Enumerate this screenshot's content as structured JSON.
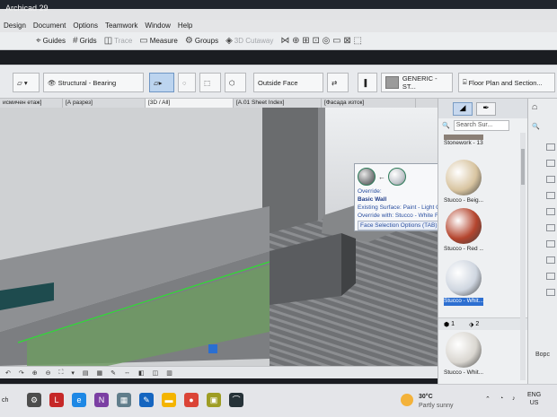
{
  "window": {
    "title": "Archicad 29"
  },
  "menu": [
    "Design",
    "Document",
    "Options",
    "Teamwork",
    "Window",
    "Help"
  ],
  "toolbar": [
    {
      "label": "Guides",
      "icon": "guides-icon",
      "enabled": true
    },
    {
      "label": "Grids",
      "icon": "grids-icon",
      "enabled": true
    },
    {
      "label": "Trace",
      "icon": "trace-icon",
      "enabled": false
    },
    {
      "label": "Measure",
      "icon": "measure-icon",
      "enabled": true
    },
    {
      "label": "Groups",
      "icon": "groups-icon",
      "enabled": true
    },
    {
      "label": "3D Cutaway",
      "icon": "cutaway-icon",
      "enabled": false
    }
  ],
  "infobox": {
    "structure": "Structural - Bearing",
    "reference": "Outside Face",
    "material": "GENERIC - ST...",
    "display": "Floor Plan and Section..."
  },
  "tabs": [
    "[А разрез]",
    "[3D / All]",
    "[A.01 Sheet Index]",
    "[Фасада изток]"
  ],
  "tab_prefix": "исмичен етаж]",
  "tooltip": {
    "line1": "Override:",
    "line2": "Basic Wall",
    "line3": "Existing Surface: Paint - Light Gray",
    "line4": "Override with: Stucco - White Fine",
    "line5": "Face Selection Options (TAB)"
  },
  "panel": {
    "search_placeholder": "Search Sur...",
    "surfaces": [
      {
        "label": "Stonework - 13",
        "color": "#8a7f76"
      },
      {
        "label": "Stucco - Beig...",
        "color": "#d8c4a0"
      },
      {
        "label": "Stucco - Red ...",
        "color": "#b4452e"
      },
      {
        "label": "Stucco - Whit...",
        "color": "#cfd6e0",
        "selected": true
      },
      {
        "label": "Stucco - Whit...",
        "color": "#d9d6d0"
      }
    ],
    "footer_count1": "1",
    "footer_count2": "2"
  },
  "nav": {
    "label": "Ворс"
  },
  "taskbar": {
    "weather_temp": "30°C",
    "weather_desc": "Partly sunny",
    "lang1": "ENG",
    "lang2": "US",
    "search": "ch",
    "apps": [
      {
        "icon": "gear-icon",
        "color": "#4d4d4d",
        "glyph": "⚙"
      },
      {
        "icon": "l-app-icon",
        "color": "#c62828",
        "glyph": "L"
      },
      {
        "icon": "edge-icon",
        "color": "#1e88e5",
        "glyph": "e"
      },
      {
        "icon": "onenote-icon",
        "color": "#7b3fa3",
        "glyph": "N"
      },
      {
        "icon": "calendar-icon",
        "color": "#607d8b",
        "glyph": "▦"
      },
      {
        "icon": "pen-icon",
        "color": "#1565c0",
        "glyph": "✎"
      },
      {
        "icon": "folder-icon",
        "color": "#f4b400",
        "glyph": "▬"
      },
      {
        "icon": "chrome-icon",
        "color": "#db4437",
        "glyph": "●"
      },
      {
        "icon": "image-icon",
        "color": "#9e9d24",
        "glyph": "▣"
      },
      {
        "icon": "archicad-icon",
        "color": "#263238",
        "glyph": "⌒"
      }
    ]
  }
}
